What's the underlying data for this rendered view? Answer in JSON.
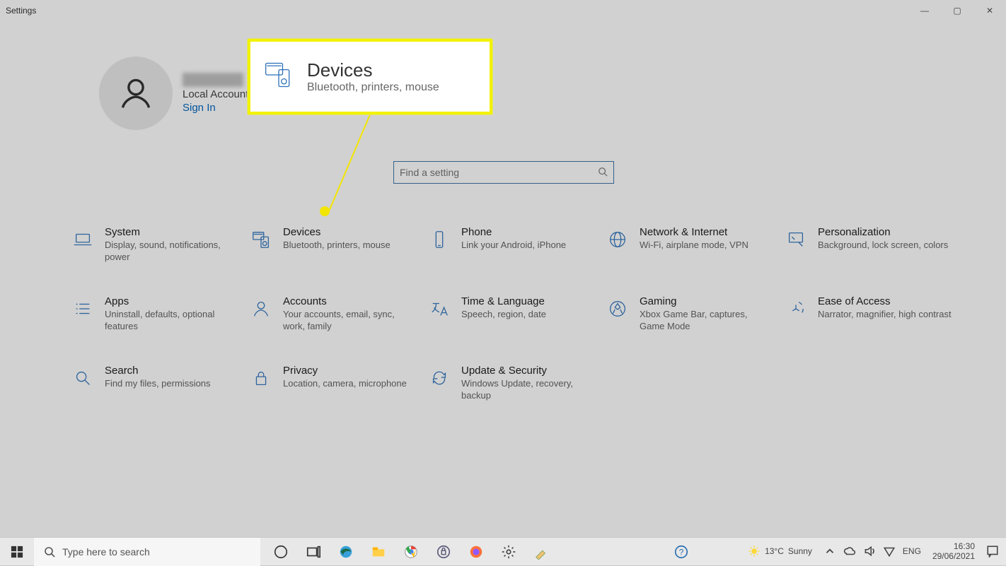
{
  "window": {
    "title": "Settings"
  },
  "controls": {
    "min": "—",
    "max": "▢",
    "close": "✕"
  },
  "user": {
    "account_type": "Local Account",
    "signin": "Sign In"
  },
  "search": {
    "placeholder": "Find a setting"
  },
  "callout": {
    "title": "Devices",
    "desc": "Bluetooth, printers, mouse"
  },
  "tiles": [
    {
      "icon": "laptop-icon",
      "title": "System",
      "desc": "Display, sound, notifications, power"
    },
    {
      "icon": "devices-icon",
      "title": "Devices",
      "desc": "Bluetooth, printers, mouse"
    },
    {
      "icon": "phone-icon",
      "title": "Phone",
      "desc": "Link your Android, iPhone"
    },
    {
      "icon": "globe-icon",
      "title": "Network & Internet",
      "desc": "Wi-Fi, airplane mode, VPN"
    },
    {
      "icon": "brush-icon",
      "title": "Personalization",
      "desc": "Background, lock screen, colors"
    },
    {
      "icon": "apps-icon",
      "title": "Apps",
      "desc": "Uninstall, defaults, optional features"
    },
    {
      "icon": "person-icon",
      "title": "Accounts",
      "desc": "Your accounts, email, sync, work, family"
    },
    {
      "icon": "language-icon",
      "title": "Time & Language",
      "desc": "Speech, region, date"
    },
    {
      "icon": "gaming-icon",
      "title": "Gaming",
      "desc": "Xbox Game Bar, captures, Game Mode"
    },
    {
      "icon": "ease-icon",
      "title": "Ease of Access",
      "desc": "Narrator, magnifier, high contrast"
    },
    {
      "icon": "search-icon",
      "title": "Search",
      "desc": "Find my files, permissions"
    },
    {
      "icon": "lock-icon",
      "title": "Privacy",
      "desc": "Location, camera, microphone"
    },
    {
      "icon": "update-icon",
      "title": "Update & Security",
      "desc": "Windows Update, recovery, backup"
    }
  ],
  "taskbar": {
    "search_placeholder": "Type here to search",
    "weather": {
      "temp": "13°C",
      "cond": "Sunny"
    },
    "lang": "ENG",
    "time": "16:30",
    "date": "29/06/2021"
  }
}
